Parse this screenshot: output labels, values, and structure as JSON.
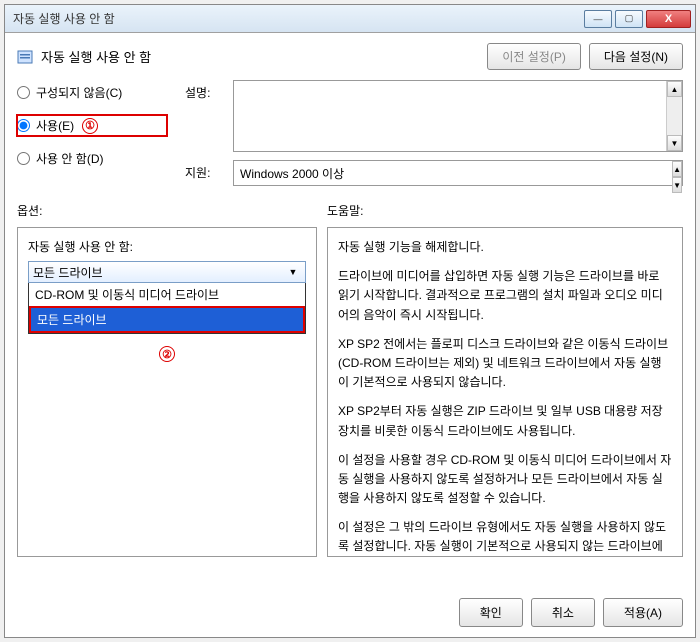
{
  "titlebar": {
    "title": "자동 실행 사용 안 함"
  },
  "header": {
    "title": "자동 실행 사용 안 함",
    "prev": "이전 설정(P)",
    "next": "다음 설정(N)"
  },
  "radios": {
    "not_configured": "구성되지 않음(C)",
    "enabled": "사용(E)",
    "disabled": "사용 안 함(D)"
  },
  "annotations": {
    "one": "①",
    "two": "②"
  },
  "desc": {
    "label": "설명:",
    "support_label": "지원:",
    "support_value": "Windows 2000 이상"
  },
  "mid": {
    "options": "옵션:",
    "help": "도움말:"
  },
  "options": {
    "label": "자동 실행 사용 안 함:",
    "selected": "모든 드라이브",
    "items": [
      "CD-ROM 및 이동식 미디어 드라이브",
      "모든 드라이브"
    ]
  },
  "help": {
    "p1": "자동 실행 기능을 해제합니다.",
    "p2": "드라이브에 미디어를 삽입하면 자동 실행 기능은 드라이브를 바로 읽기 시작합니다. 결과적으로 프로그램의 설치 파일과 오디오 미디어의 음악이 즉시 시작됩니다.",
    "p3": "XP SP2 전에서는 플로피 디스크 드라이브와 같은 이동식 드라이브(CD-ROM 드라이브는 제외) 및 네트워크 드라이브에서 자동 실행이 기본적으로 사용되지 않습니다.",
    "p4": "XP SP2부터 자동 실행은 ZIP 드라이브 및 일부 USB 대용량 저장 장치를 비롯한 이동식 드라이브에도 사용됩니다.",
    "p5": "이 설정을 사용할 경우 CD-ROM 및 이동식 미디어 드라이브에서 자동 실행을 사용하지 않도록 설정하거나 모든 드라이브에서 자동 실행을 사용하지 않도록 설정할 수 있습니다.",
    "p6": "이 설정은 그 밖의 드라이브 유형에서도 자동 실행을 사용하지 않도록 설정합니다. 자동 실행이 기본적으로 사용되지 않는 드라이브에서 이 설정을 사용하여 자동 실행을 사용할 수 없습니다."
  },
  "footer": {
    "ok": "확인",
    "cancel": "취소",
    "apply": "적용(A)"
  }
}
